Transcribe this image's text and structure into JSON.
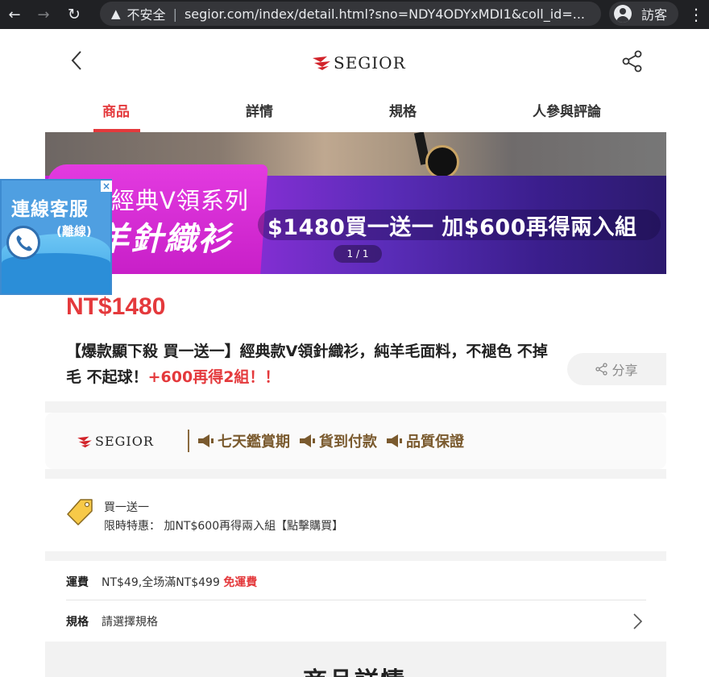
{
  "browser": {
    "insecure_label": "不安全",
    "url": "segior.com/index/detail.html?sno=NDY4ODYxMDI1&coll_id=...",
    "profile_label": "訪客"
  },
  "header": {
    "logo_text": "SEGIOR"
  },
  "tabs": [
    {
      "label": "商品",
      "active": true
    },
    {
      "label": "詳情",
      "active": false
    },
    {
      "label": "規格",
      "active": false
    },
    {
      "label": "人參與評論",
      "active": false
    }
  ],
  "banner": {
    "line1": "經典V領系列",
    "line2": "羊針織衫",
    "promo": "$1480買一送一 加$600再得兩入組",
    "pager": "1 / 1"
  },
  "customer_service": {
    "title": "連線客服",
    "status": "(離線)",
    "close": "×"
  },
  "product": {
    "price": "NT$1480",
    "title_main": "【爆款顯下殺 買一送一】經典款V領針織衫，純羊毛面料，不褪色 不掉毛 不起球！",
    "title_highlight": "+600再得2組！！",
    "share_label": "分享"
  },
  "brand": {
    "logo_text": "SEGIOR",
    "badges": [
      "七天鑑賞期",
      "貨到付款",
      "品質保證"
    ]
  },
  "promotion": {
    "title": "買一送一",
    "desc": "限時特惠： 加NT$600再得兩入組【點擊購買】"
  },
  "shipping": {
    "label": "運費",
    "value": "NT$49,全场滿NT$499",
    "free": "免運費"
  },
  "spec": {
    "label": "規格",
    "value": "請選擇規格"
  },
  "detail": {
    "title": "商品詳情"
  },
  "colors": {
    "accent": "#e4393c",
    "brand_gold": "#7a5a2e",
    "chrome_bg": "#202124"
  }
}
